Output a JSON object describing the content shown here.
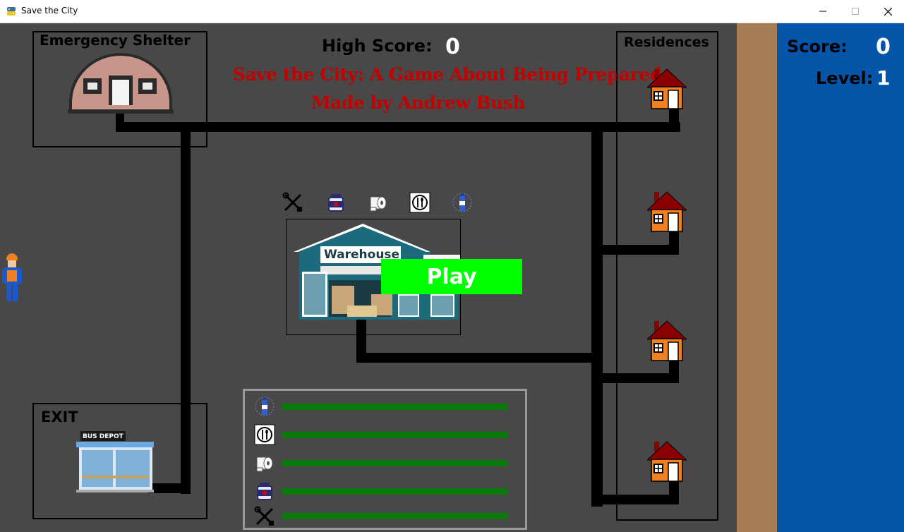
{
  "window": {
    "title": "Save the City",
    "controls": [
      "minimize",
      "maximize",
      "close"
    ]
  },
  "header": {
    "high_score_label": "High Score:",
    "high_score_value": "0",
    "game_title": "Save the City: A Game About Being Prepared",
    "credit": "Made by Andrew Bush"
  },
  "areas": {
    "shelter_label": "Emergency Shelter",
    "residences_label": "Residences",
    "exit_label": "EXIT",
    "bus_depot_sign": "BUS DEPOT",
    "warehouse_sign": "Warehouse"
  },
  "score_panel": {
    "score_label": "Score:",
    "score_value": "0",
    "level_label": "Level:",
    "level_value": "1"
  },
  "play_button": {
    "label": "Play"
  },
  "supplies": [
    {
      "name": "tools",
      "icon": "tools-icon",
      "level": 1.0
    },
    {
      "name": "medicine",
      "icon": "medicine-jar-icon",
      "level": 1.0
    },
    {
      "name": "toilet paper",
      "icon": "toilet-paper-icon",
      "level": 1.0
    },
    {
      "name": "food",
      "icon": "plate-cutlery-icon",
      "level": 1.0
    },
    {
      "name": "water",
      "icon": "water-bottle-icon",
      "level": 1.0
    }
  ],
  "colors": {
    "background": "#484848",
    "score_panel": "#0555a8",
    "dirt_strip": "#a57c53",
    "play_button": "#00ff00",
    "title_text": "#c40000",
    "supply_bar": "#0a7a0a"
  }
}
